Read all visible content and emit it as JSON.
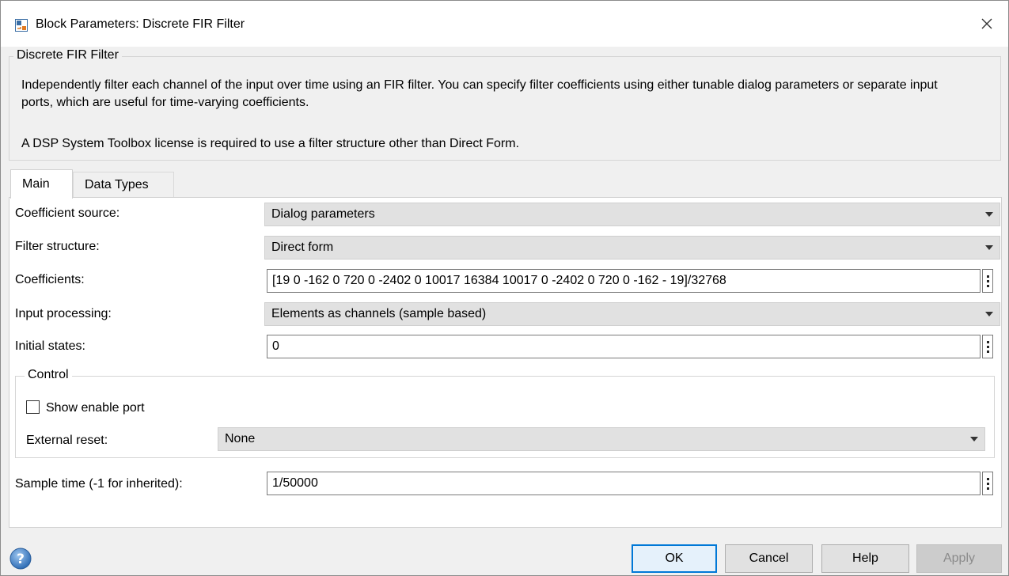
{
  "window": {
    "title": "Block Parameters: Discrete FIR Filter"
  },
  "description": {
    "group_title": "Discrete FIR Filter",
    "text1": "Independently filter each channel of the input over time using an FIR filter. You can specify filter coefficients using either tunable dialog parameters or separate input ports, which are useful for time-varying coefficients.",
    "text2": "A DSP System Toolbox license is required to use a filter structure other than Direct Form."
  },
  "tabs": [
    {
      "label": "Main",
      "active": true
    },
    {
      "label": "Data Types",
      "active": false
    }
  ],
  "params": {
    "coefficient_source": {
      "label": "Coefficient source:",
      "value": "Dialog parameters"
    },
    "filter_structure": {
      "label": "Filter structure:",
      "value": "Direct form"
    },
    "coefficients": {
      "label": "Coefficients:",
      "value": "[19 0 -162 0 720 0 -2402 0 10017 16384 10017 0 -2402 0 720 0 -162 - 19]/32768"
    },
    "input_processing": {
      "label": "Input processing:",
      "value": "Elements as channels (sample based)"
    },
    "initial_states": {
      "label": "Initial states:",
      "value": "0"
    },
    "sample_time": {
      "label": "Sample time (-1 for inherited):",
      "value": "1/50000"
    }
  },
  "control": {
    "group_title": "Control",
    "show_enable_port": {
      "label": "Show enable port",
      "checked": false
    },
    "external_reset": {
      "label": "External reset:",
      "value": "None"
    }
  },
  "buttons": {
    "ok": "OK",
    "cancel": "Cancel",
    "help": "Help",
    "apply": "Apply"
  },
  "icons": {
    "app": "simulink-block-icon",
    "close": "close-icon",
    "help": "help-question-icon",
    "more": "vertical-ellipsis-icon",
    "dropdown": "dropdown-arrow-icon"
  },
  "colors": {
    "accent": "#0078d7",
    "dialog_bg": "#f0f0f0",
    "panel_bg": "#ffffff"
  }
}
